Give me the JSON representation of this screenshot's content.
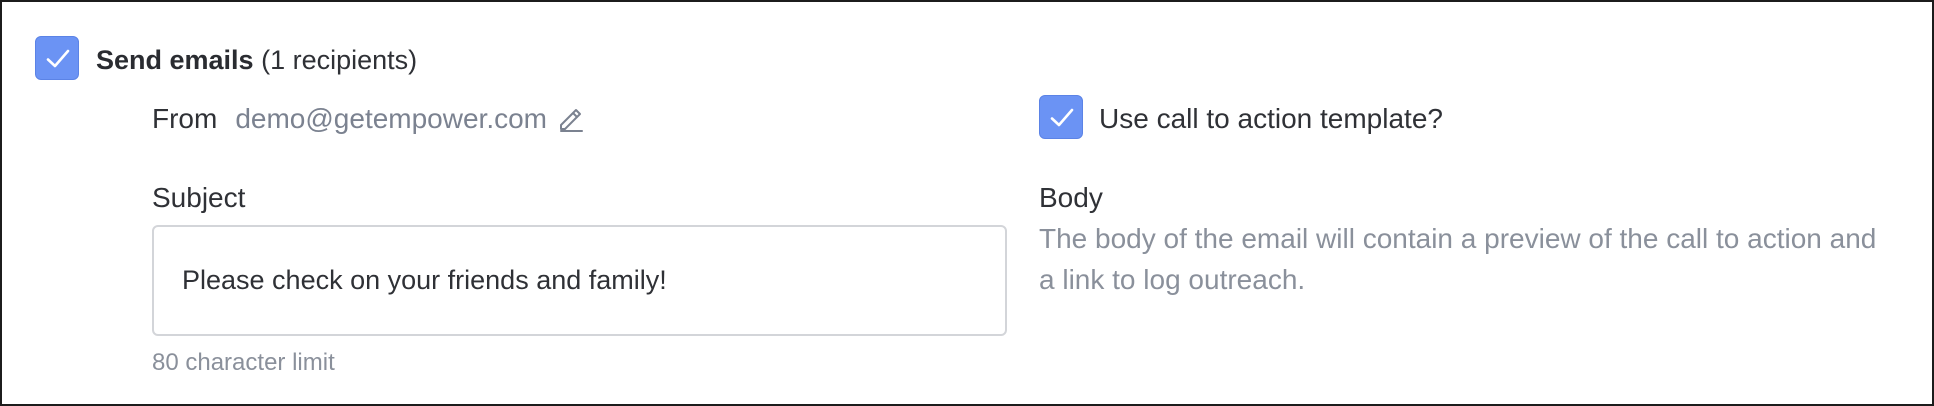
{
  "send_emails": {
    "checked": true,
    "label": "Send emails",
    "recipients": "(1 recipients)"
  },
  "from": {
    "label": "From",
    "email": "demo@getempower.com",
    "edit_icon": "pencil-icon"
  },
  "call_to_action": {
    "checked": true,
    "label": "Use call to action template?"
  },
  "subject": {
    "label": "Subject",
    "value": "Please check on your friends and family!",
    "limit_hint": "80 character limit"
  },
  "body": {
    "label": "Body",
    "description": "The body of the email will contain a preview of the call to action and a link to log outreach."
  },
  "colors": {
    "checkbox_accent": "#6b93f4",
    "muted_text": "#8a909b",
    "border": "#d3d5d9"
  }
}
